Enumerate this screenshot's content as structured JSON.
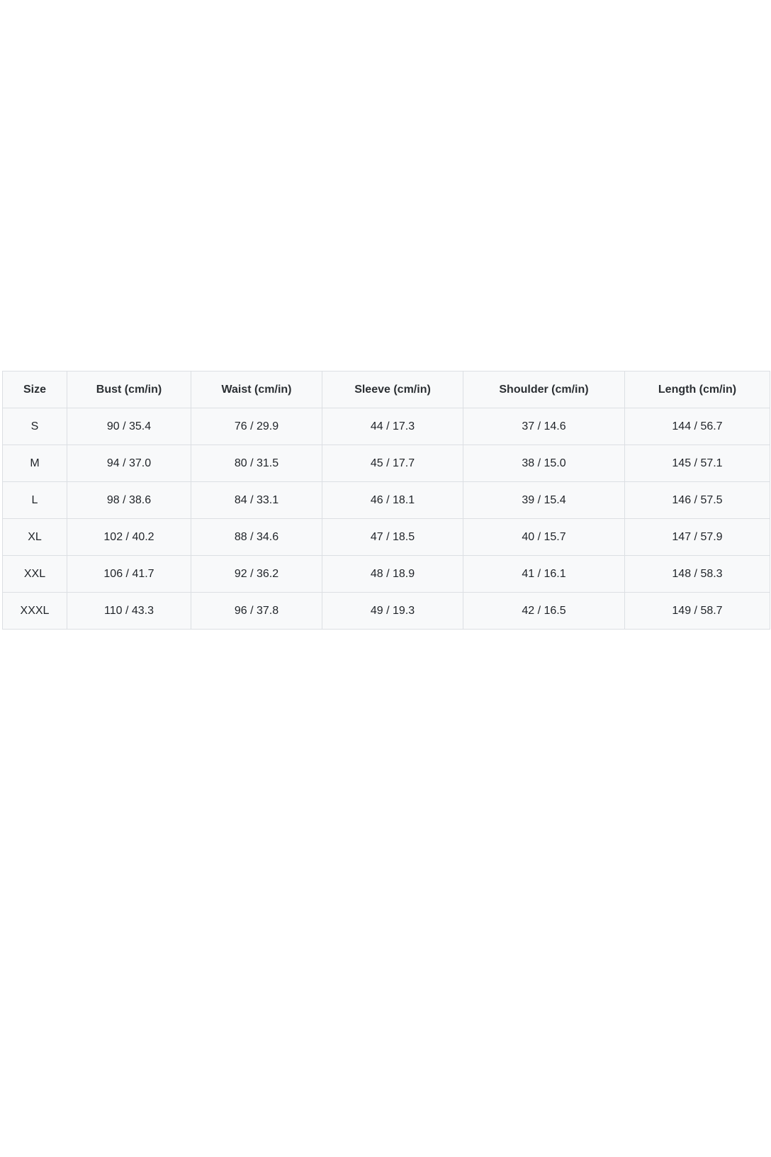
{
  "size_chart": {
    "headers": [
      "Size",
      "Bust (cm/in)",
      "Waist (cm/in)",
      "Sleeve (cm/in)",
      "Shoulder (cm/in)",
      "Length (cm/in)"
    ],
    "rows": [
      [
        "S",
        "90 / 35.4",
        "76 / 29.9",
        "44 / 17.3",
        "37 / 14.6",
        "144 / 56.7"
      ],
      [
        "M",
        "94 / 37.0",
        "80 / 31.5",
        "45 / 17.7",
        "38 / 15.0",
        "145 / 57.1"
      ],
      [
        "L",
        "98 / 38.6",
        "84 / 33.1",
        "46 / 18.1",
        "39 / 15.4",
        "146 / 57.5"
      ],
      [
        "XL",
        "102 / 40.2",
        "88 / 34.6",
        "47 / 18.5",
        "40 / 15.7",
        "147 / 57.9"
      ],
      [
        "XXL",
        "106 / 41.7",
        "92 / 36.2",
        "48 / 18.9",
        "41 / 16.1",
        "148 / 58.3"
      ],
      [
        "XXXL",
        "110 / 43.3",
        "96 / 37.8",
        "49 / 19.3",
        "42 / 16.5",
        "149 / 58.7"
      ]
    ]
  }
}
